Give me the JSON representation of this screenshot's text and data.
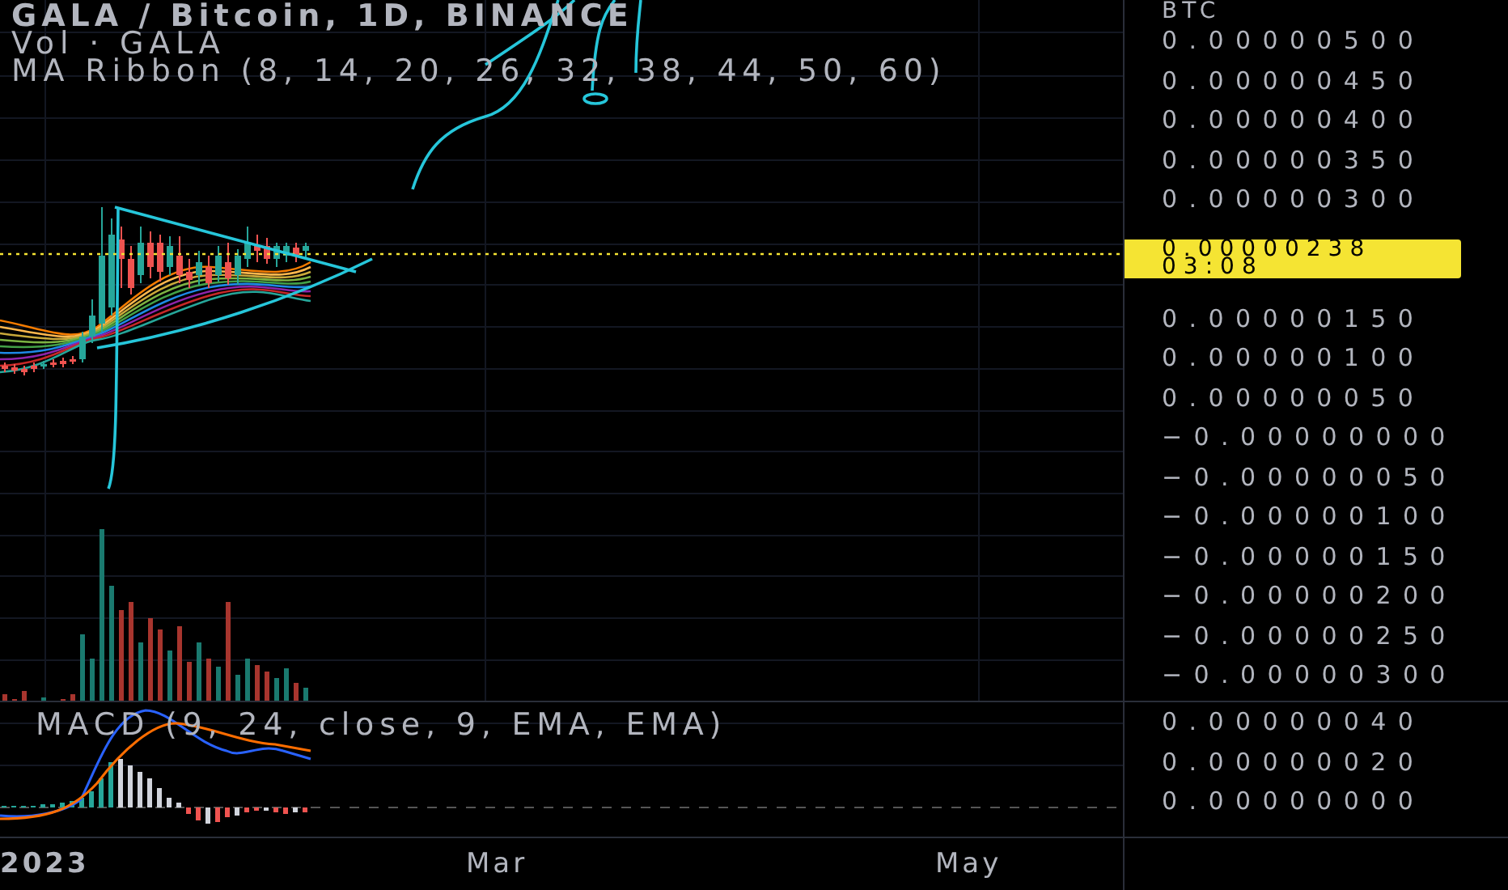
{
  "legend": {
    "title": "GALA / Bitcoin, 1D, BINANCE",
    "indicators": [
      "Vol · GALA",
      "MA Ribbon (8, 14, 20, 26, 32, 38, 44, 50, 60)"
    ]
  },
  "price_scale": {
    "unit": "BTC",
    "items": [
      {
        "kind": "tick",
        "label": "0.00000500"
      },
      {
        "kind": "tick",
        "label": "0.00000450"
      },
      {
        "kind": "tick",
        "label": "0.00000400"
      },
      {
        "kind": "tick",
        "label": "0.00000350"
      },
      {
        "kind": "tick",
        "label": "0.00000300"
      },
      {
        "kind": "price_tag",
        "price": "0.00000238",
        "countdown": "03:08"
      },
      {
        "kind": "tick",
        "label": "0.00000150"
      },
      {
        "kind": "tick",
        "label": "0.00000100"
      },
      {
        "kind": "tick",
        "label": "0.00000050"
      },
      {
        "kind": "tick",
        "label": "−0.00000000"
      },
      {
        "kind": "tick",
        "label": "−0.00000050"
      },
      {
        "kind": "tick",
        "label": "−0.00000100"
      },
      {
        "kind": "tick",
        "label": "−0.00000150"
      },
      {
        "kind": "tick",
        "label": "−0.00000200"
      },
      {
        "kind": "tick",
        "label": "−0.00000250"
      },
      {
        "kind": "tick",
        "label": "−0.00000300"
      }
    ]
  },
  "macd": {
    "title": "MACD (9, 24, close, 9, EMA, EMA)",
    "ticks": [
      "0.00000040",
      "0.00000020",
      "0.00000000"
    ]
  },
  "time_axis": [
    "2023",
    "Mar",
    "May"
  ]
}
